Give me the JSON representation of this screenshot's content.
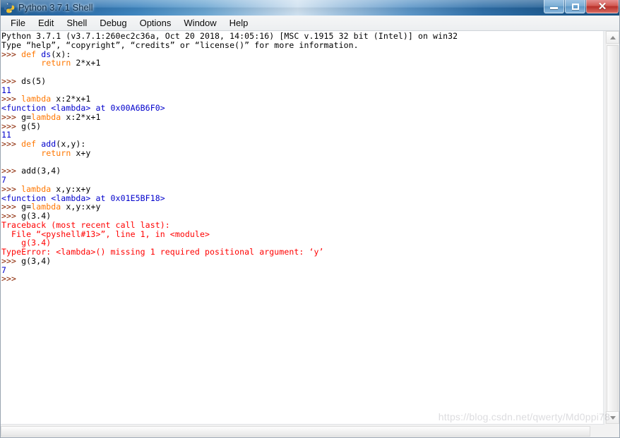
{
  "window": {
    "title": "Python 3.7.1 Shell",
    "icon": "python-idle-icon",
    "controls": {
      "minimize_label": "Minimize",
      "maximize_label": "Maximize",
      "close_label": "✕"
    }
  },
  "menubar": {
    "items": [
      {
        "label": "File"
      },
      {
        "label": "Edit"
      },
      {
        "label": "Shell"
      },
      {
        "label": "Debug"
      },
      {
        "label": "Options"
      },
      {
        "label": "Window"
      },
      {
        "label": "Help"
      }
    ]
  },
  "shell": {
    "lines": [
      {
        "segments": [
          {
            "text": "Python 3.7.1 (v3.7.1:260ec2c36a, Oct 20 2018, 14:05:16) [MSC v.1915 32 bit (Intel)] on win32",
            "style": "plain"
          }
        ]
      },
      {
        "segments": [
          {
            "text": "Type “help”, “copyright”, “credits” or “license()” for more information.",
            "style": "plain"
          }
        ]
      },
      {
        "segments": [
          {
            "text": ">>> ",
            "style": "prompt"
          },
          {
            "text": "def ",
            "style": "kw"
          },
          {
            "text": "ds",
            "style": "def"
          },
          {
            "text": "(x):",
            "style": "plain"
          }
        ]
      },
      {
        "segments": [
          {
            "text": "        ",
            "style": "plain"
          },
          {
            "text": "return ",
            "style": "kw"
          },
          {
            "text": "2*x+1",
            "style": "plain"
          }
        ]
      },
      {
        "segments": [
          {
            "text": "",
            "style": "plain"
          }
        ]
      },
      {
        "segments": [
          {
            "text": ">>> ",
            "style": "prompt"
          },
          {
            "text": "ds(5)",
            "style": "plain"
          }
        ]
      },
      {
        "segments": [
          {
            "text": "11",
            "style": "out"
          }
        ]
      },
      {
        "segments": [
          {
            "text": ">>> ",
            "style": "prompt"
          },
          {
            "text": "lambda ",
            "style": "kw"
          },
          {
            "text": "x:2*x+1",
            "style": "plain"
          }
        ]
      },
      {
        "segments": [
          {
            "text": "<function <lambda> at 0x00A6B6F0>",
            "style": "out"
          }
        ]
      },
      {
        "segments": [
          {
            "text": ">>> ",
            "style": "prompt"
          },
          {
            "text": "g=",
            "style": "plain"
          },
          {
            "text": "lambda ",
            "style": "kw"
          },
          {
            "text": "x:2*x+1",
            "style": "plain"
          }
        ]
      },
      {
        "segments": [
          {
            "text": ">>> ",
            "style": "prompt"
          },
          {
            "text": "g(5)",
            "style": "plain"
          }
        ]
      },
      {
        "segments": [
          {
            "text": "11",
            "style": "out"
          }
        ]
      },
      {
        "segments": [
          {
            "text": ">>> ",
            "style": "prompt"
          },
          {
            "text": "def ",
            "style": "kw"
          },
          {
            "text": "add",
            "style": "def"
          },
          {
            "text": "(x,y):",
            "style": "plain"
          }
        ]
      },
      {
        "segments": [
          {
            "text": "        ",
            "style": "plain"
          },
          {
            "text": "return ",
            "style": "kw"
          },
          {
            "text": "x+y",
            "style": "plain"
          }
        ]
      },
      {
        "segments": [
          {
            "text": "",
            "style": "plain"
          }
        ]
      },
      {
        "segments": [
          {
            "text": ">>> ",
            "style": "prompt"
          },
          {
            "text": "add(3,4)",
            "style": "plain"
          }
        ]
      },
      {
        "segments": [
          {
            "text": "7",
            "style": "out"
          }
        ]
      },
      {
        "segments": [
          {
            "text": ">>> ",
            "style": "prompt"
          },
          {
            "text": "lambda ",
            "style": "kw"
          },
          {
            "text": "x,y:x+y",
            "style": "plain"
          }
        ]
      },
      {
        "segments": [
          {
            "text": "<function <lambda> at 0x01E5BF18>",
            "style": "out"
          }
        ]
      },
      {
        "segments": [
          {
            "text": ">>> ",
            "style": "prompt"
          },
          {
            "text": "g=",
            "style": "plain"
          },
          {
            "text": "lambda ",
            "style": "kw"
          },
          {
            "text": "x,y:x+y",
            "style": "plain"
          }
        ]
      },
      {
        "segments": [
          {
            "text": ">>> ",
            "style": "prompt"
          },
          {
            "text": "g(3.4)",
            "style": "plain"
          }
        ]
      },
      {
        "segments": [
          {
            "text": "Traceback (most recent call last):",
            "style": "err"
          }
        ]
      },
      {
        "segments": [
          {
            "text": "  File “<pyshell#13>”, line 1, in <module>",
            "style": "err"
          }
        ]
      },
      {
        "segments": [
          {
            "text": "    g(3.4)",
            "style": "err"
          }
        ]
      },
      {
        "segments": [
          {
            "text": "TypeError: <lambda>() missing 1 required positional argument: ‘y’",
            "style": "err"
          }
        ]
      },
      {
        "segments": [
          {
            "text": ">>> ",
            "style": "prompt"
          },
          {
            "text": "g(3,4)",
            "style": "plain"
          }
        ]
      },
      {
        "segments": [
          {
            "text": "7",
            "style": "out"
          }
        ]
      },
      {
        "segments": [
          {
            "text": ">>> ",
            "style": "prompt"
          }
        ]
      }
    ]
  },
  "watermark": {
    "text": "https://blog.csdn.net/qwerty/Md0ppi78"
  },
  "colors": {
    "prompt": "#8b2500",
    "keyword": "#ff7700",
    "output": "#0000cc",
    "error": "#ff0000",
    "text": "#000000",
    "background": "#ffffff",
    "titlebar_accent": "#2a6ba8"
  }
}
